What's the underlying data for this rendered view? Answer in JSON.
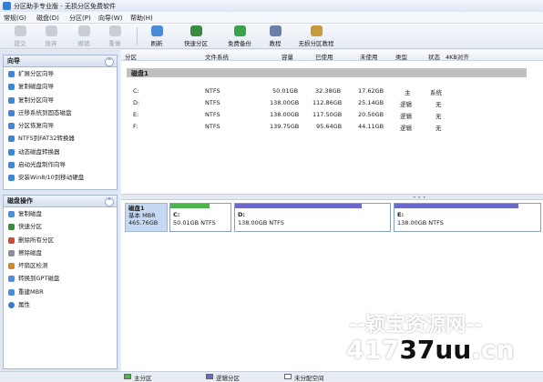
{
  "window": {
    "title": "分区助手专业版 - 无损分区免费软件"
  },
  "menu": [
    "常规(G)",
    "磁盘(D)",
    "分区(P)",
    "向导(W)",
    "帮助(H)"
  ],
  "toolbar": {
    "commit": "提交",
    "discard": "放弃",
    "undo": "撤销",
    "redo": "重做",
    "refresh": "刷新",
    "quick_partition": "快速分区",
    "free_backup": "免费备份",
    "tutorial": "教程",
    "lossless_tutorial": "无损分区教程"
  },
  "wizard_panel": {
    "title": "向导",
    "items": [
      "扩展分区向导",
      "复制磁盘向导",
      "复制分区向导",
      "迁移系统到固态磁盘",
      "分区恢复向导",
      "NTFS到FAT32转换器",
      "动态磁盘转换器",
      "启动光盘制作向导",
      "安装Win8/10到移动硬盘"
    ]
  },
  "disk_ops_panel": {
    "title": "磁盘操作",
    "items": [
      "复制磁盘",
      "快速分区",
      "删除所有分区",
      "擦除磁盘",
      "坏扇区检测",
      "转换到GPT磁盘",
      "重建MBR",
      "属性"
    ]
  },
  "table": {
    "headers": [
      "分区",
      "文件系统",
      "容量",
      "已使用",
      "未使用",
      "类型",
      "状态",
      "4KB对齐"
    ],
    "disk_label": "磁盘1",
    "rows": [
      [
        "C:",
        "NTFS",
        "50.01GB",
        "32.38GB",
        "17.62GB",
        "主",
        "系统"
      ],
      [
        "D:",
        "NTFS",
        "138.00GB",
        "112.86GB",
        "25.14GB",
        "逻辑",
        "无"
      ],
      [
        "E:",
        "NTFS",
        "138.00GB",
        "117.50GB",
        "20.50GB",
        "逻辑",
        "无"
      ],
      [
        "F:",
        "NTFS",
        "139.75GB",
        "95.64GB",
        "44.11GB",
        "逻辑",
        "无"
      ]
    ]
  },
  "diskmap": {
    "disk_name": "磁盘1",
    "disk_type": "基本 MBR",
    "disk_size": "465.76GB",
    "partitions": [
      {
        "label": "C:",
        "detail": "50.01GB NTFS",
        "used_fraction": 0.65,
        "color": "#4db34d"
      },
      {
        "label": "D:",
        "detail": "138.00GB NTFS",
        "used_fraction": 0.82,
        "color": "#6a68c8"
      },
      {
        "label": "E:",
        "detail": "138.00GB NTFS",
        "used_fraction": 0.85,
        "color": "#6a68c8"
      }
    ]
  },
  "legend": [
    "主分区",
    "逻辑分区",
    "未分配空间"
  ],
  "watermark": {
    "line1": "--颖宝资源网--",
    "line2_a": "417",
    "line2_b": "37uu",
    "line2_c": ".cn"
  }
}
